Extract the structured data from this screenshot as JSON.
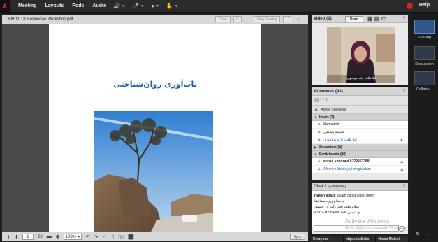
{
  "menubar": {
    "logo": "A",
    "items": [
      "Meeting",
      "Layouts",
      "Pods",
      "Audio"
    ],
    "help": "Help",
    "colors": {
      "record": "#dd2222",
      "speaker": "#44cc44"
    }
  },
  "share": {
    "filename": "1399 11 18 Resilience Workshop.pdf",
    "draw_label": "Draw",
    "stop_sharing_label": "Stop Sharing",
    "slide_title": "تاب‌آوری روان‌شناختی",
    "page_current": "1",
    "page_total": "/ 23",
    "zoom": "108%",
    "sync_label": "Sync"
  },
  "video": {
    "title": "Video",
    "count": "(1)",
    "start_label": "Start",
    "caption": "لیلا طلب زاده نوبلدوزی"
  },
  "attendees": {
    "title": "Attendees",
    "count": "(43)",
    "active_speakers": "Active Speakers",
    "hosts_label": "Hosts (3)",
    "hosts": [
      {
        "name": "Samadieh",
        "color": "#222222"
      },
      {
        "name": "سکینه رستمی",
        "color": "#222222"
      },
      {
        "name": "لیلا طلب زاده نوبلدوزی",
        "color": "#2366b5"
      }
    ],
    "presenters_label": "Presenters (0)",
    "participants_label": "Participants (40)",
    "participants": [
      {
        "name": "abbas khosravi 6129953388",
        "color": "#222222"
      },
      {
        "name": "Afsaneh khodayari moghadam",
        "color": "#2366b5"
      }
    ]
  },
  "chat": {
    "title": "Chat 3",
    "scope": "(Everyone)",
    "messages": [
      {
        "sender": "Hasan abasi:",
        "text": " salam ostad vaght bkhir"
      },
      {
        "sender": "",
        "text": "با سلام زیره صفایشا"
      },
      {
        "sender": "",
        "text": "سلام وقت بخیر دکتر آن جسنور"
      },
      {
        "sender": "",
        "text": "ASIYEH SNEMIDEN ی ثمیس"
      }
    ],
    "watermark": "Activate Windows",
    "watermark_sub": "Go to Settings to activate Windows."
  },
  "bottom_tabs": [
    "Everyone",
    "https://ac5.bio",
    "Homa Maleki"
  ],
  "layouts": {
    "items": [
      "Sharing",
      "Discussion",
      "Collabo..."
    ]
  }
}
